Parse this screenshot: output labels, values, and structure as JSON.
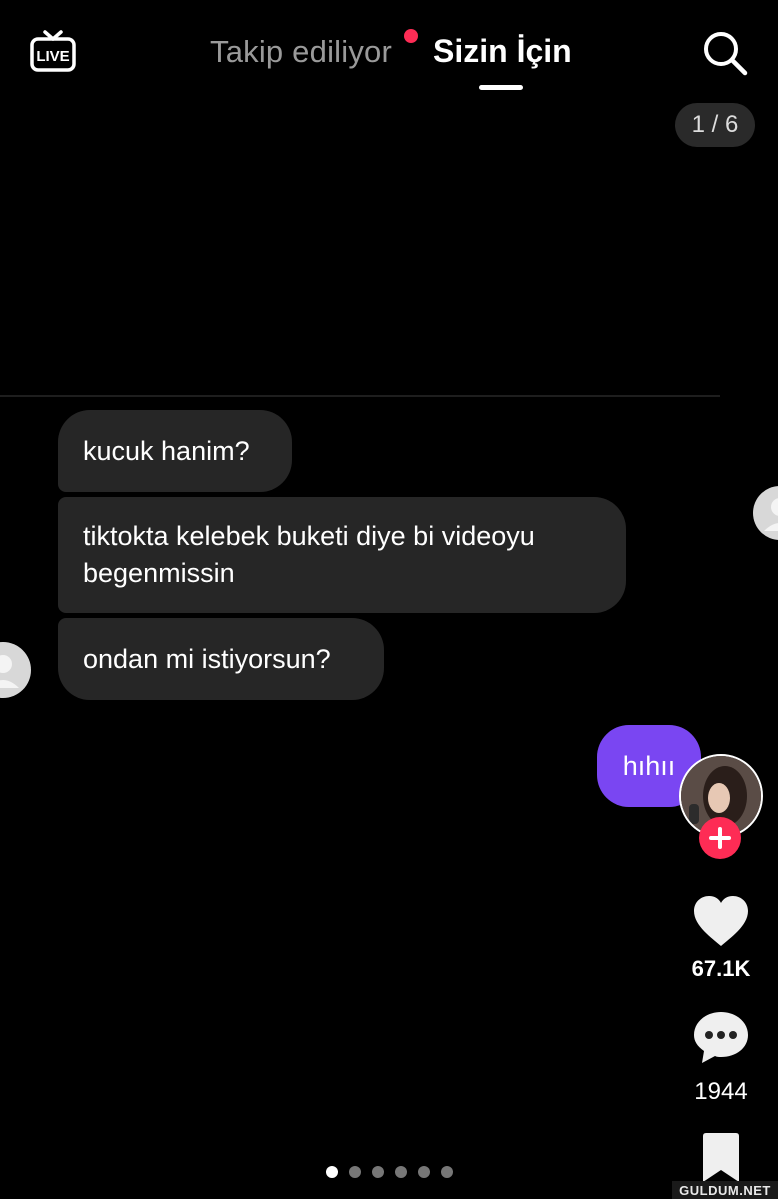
{
  "header": {
    "live_label": "LIVE",
    "tab_following": "Takip ediliyor",
    "tab_for_you": "Sizin İçin"
  },
  "page_counter": "1 / 6",
  "chat": {
    "messages": [
      {
        "side": "left",
        "text": "kucuk hanim?"
      },
      {
        "side": "left",
        "text": "tiktokta kelebek buketi diye bi videoyu begenmissin"
      },
      {
        "side": "left",
        "text": "ondan mi istiyorsun?"
      },
      {
        "side": "right",
        "text": "hıhıı"
      }
    ]
  },
  "actions": {
    "like_count": "67.1K",
    "comment_count": "1944"
  },
  "carousel": {
    "total": 6,
    "active_index": 0
  },
  "watermark": "GULDUM.NET",
  "colors": {
    "background": "#000000",
    "bubble_received": "#262626",
    "bubble_sent": "#7a46f2",
    "accent_red": "#fe2c55"
  },
  "icons": [
    "live-icon",
    "search-icon",
    "heart-icon",
    "comment-icon",
    "bookmark-icon",
    "plus-icon"
  ]
}
